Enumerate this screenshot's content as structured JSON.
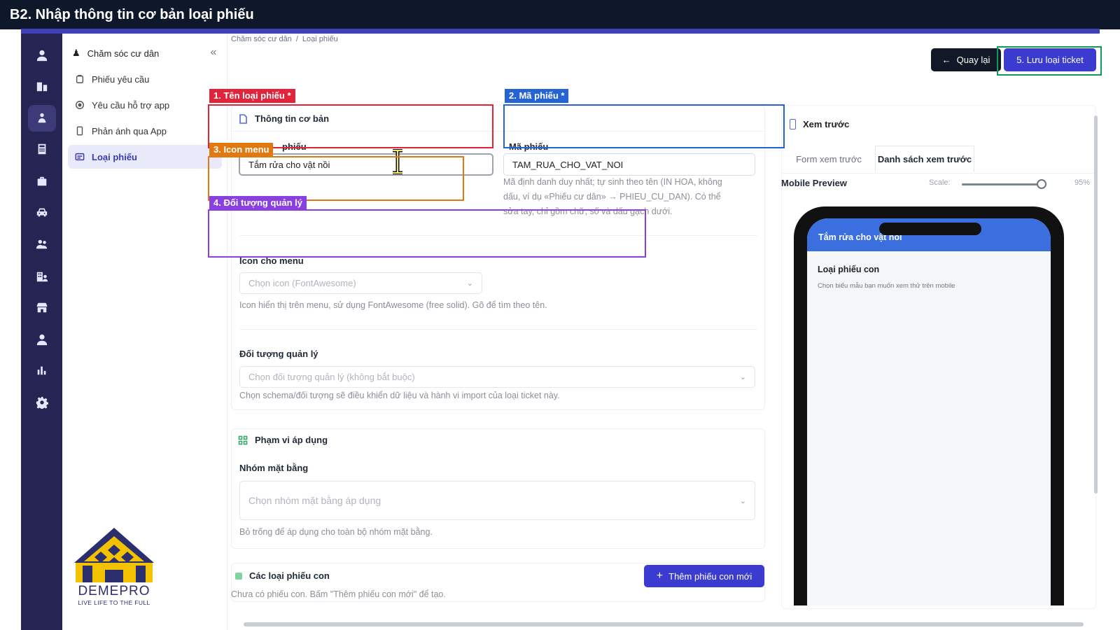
{
  "banner": {
    "title": "B2. Nhập thông tin cơ bản loại phiếu"
  },
  "subnav": {
    "group_label": "Chăm sóc cư dân",
    "collapse_icon": "chevrons-left-icon",
    "items": [
      {
        "label": "Phiếu yêu cầu",
        "icon": "clipboard-icon",
        "active": false
      },
      {
        "label": "Yêu cầu hỗ trợ app",
        "icon": "target-icon",
        "active": false
      },
      {
        "label": "Phản ánh qua App",
        "icon": "phone-icon",
        "active": false
      },
      {
        "label": "Loại phiếu",
        "icon": "id-card-icon",
        "active": true
      }
    ]
  },
  "breadcrumb": {
    "part1": "Chăm sóc cư dân",
    "sep": "/",
    "part2": "Loại phiếu"
  },
  "actions": {
    "back_label": "Quay lại",
    "save_label": "5. Lưu loại ticket"
  },
  "basic_info": {
    "header": "Thông tin cơ bản",
    "name_label_partial": "phiếu",
    "name_value": "Tắm rửa cho vật nồi",
    "code_label": "Mã phiếu",
    "code_value": "TAM_RUA_CHO_VAT_NOI",
    "code_help_1": "Mã định danh duy nhất; tự sinh theo tên (IN HOA, không",
    "code_help_2": "dấu, ví dụ «Phiếu cư dân» → PHIEU_CU_DAN). Có thể",
    "code_help_3": "sửa tay, chỉ gồm chữ, số và dấu gạch dưới.",
    "icon_label": "Icon cho menu",
    "icon_placeholder": "Chọn icon (FontAwesome)",
    "icon_help": "Icon hiển thị trên menu, sử dụng FontAwesome (free solid). Gõ để tìm theo tên.",
    "object_label": "Đối tượng quản lý",
    "object_placeholder": "Chọn đối tượng quản lý (không bắt buộc)",
    "object_help": "Chọn schema/đối tượng sẽ điều khiển dữ liệu và hành vi import của loại ticket này."
  },
  "scope": {
    "header": "Phạm vi áp dụng",
    "group_label": "Nhóm mặt bằng",
    "group_placeholder": "Chọn nhóm mặt bằng áp dụng",
    "group_help": "Bỏ trống để áp dụng cho toàn bộ nhóm mặt bằng."
  },
  "children": {
    "header": "Các loại phiếu con",
    "add_label": "Thêm phiếu con mới",
    "empty_text": "Chưa có phiếu con. Bấm \"Thêm phiếu con mới\" để tạo."
  },
  "preview": {
    "header": "Xem trước",
    "tab_form": "Form xem trước",
    "tab_list": "Danh sách xem trước",
    "mobile_label": "Mobile Preview",
    "scale_label": "Scale:",
    "scale_value": "95%",
    "scale_fraction": 0.95,
    "phone_title": "Tắm rửa cho vật nồi",
    "phone_section": "Loại phiếu con",
    "phone_desc": "Chọn biểu mẫu bạn muốn xem thử trên mobile"
  },
  "annotations": [
    {
      "label": "1. Tên loại phiếu *",
      "color": "#e0243a"
    },
    {
      "label": "2. Mã phiếu *",
      "color": "#2463d6"
    },
    {
      "label": "3. Icon menu",
      "color": "#e07a10"
    },
    {
      "label": "4. Đối tượng quản lý",
      "color": "#8a3fe0"
    },
    {
      "label": "5. Lưu loại ticket",
      "color": "#0f9a5c"
    }
  ],
  "logo": {
    "brand": "DEMEPRO",
    "tagline": "LIVE LIFE TO THE FULL"
  },
  "colors": {
    "rail": "#262452",
    "accent": "#3b3bd0",
    "banner": "#0f172a"
  }
}
